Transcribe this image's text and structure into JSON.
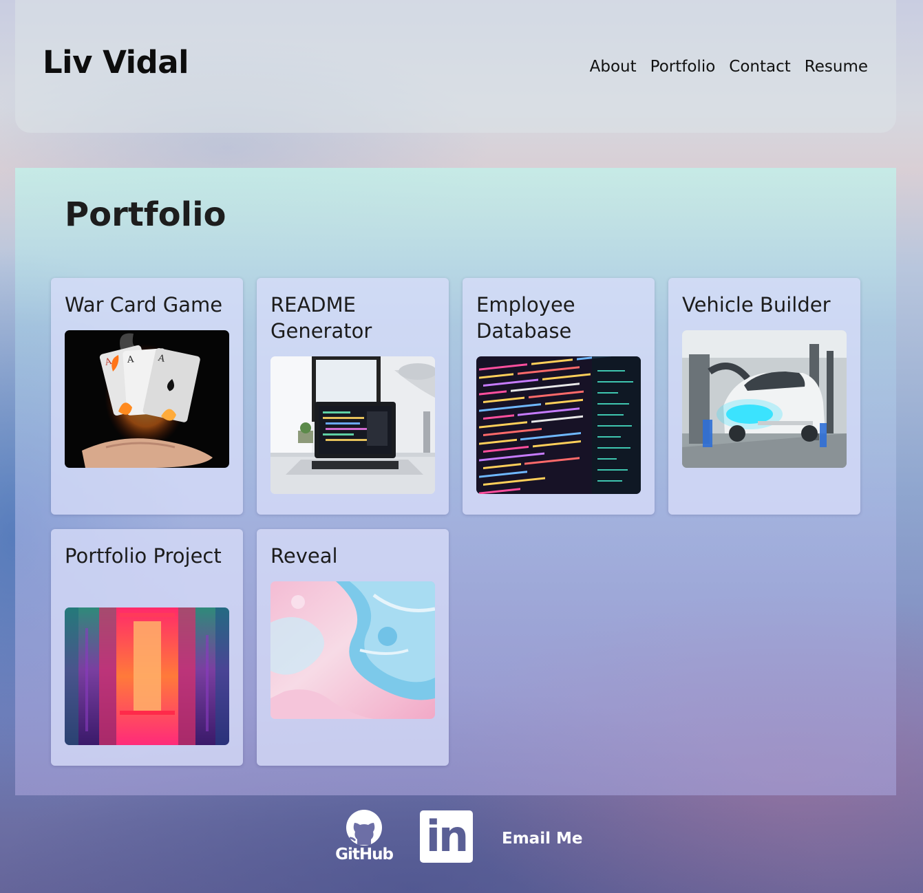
{
  "header": {
    "brand": "Liv Vidal",
    "nav": [
      "About",
      "Portfolio",
      "Contact",
      "Resume"
    ]
  },
  "portfolio": {
    "title": "Portfolio",
    "projects": [
      {
        "title": "War Card Game",
        "image": "burning-playing-cards"
      },
      {
        "title": "README Generator",
        "image": "laptop-on-desk"
      },
      {
        "title": "Employee Database",
        "image": "code-on-screen"
      },
      {
        "title": "Vehicle Builder",
        "image": "car-assembly-line"
      },
      {
        "title": "Portfolio Project",
        "image": "neon-corridor"
      },
      {
        "title": "Reveal",
        "image": "pastel-fluid-paint"
      }
    ]
  },
  "footer": {
    "github_label": "GitHub",
    "linkedin_label": "in",
    "email_label": "Email Me"
  }
}
